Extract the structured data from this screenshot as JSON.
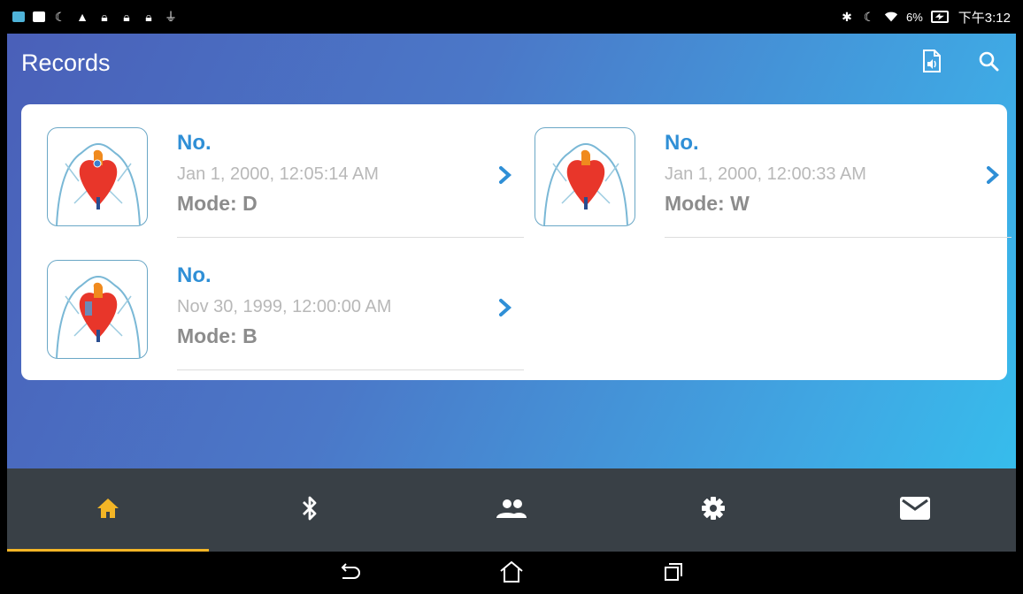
{
  "status_bar": {
    "battery_percent": "6%",
    "time": "下午3:12"
  },
  "app_bar": {
    "title": "Records",
    "icons": [
      "audio-file-icon",
      "search-icon"
    ]
  },
  "records": [
    {
      "no": "No.",
      "date": "Jan 1, 2000, 12:05:14 AM",
      "mode": "Mode: D"
    },
    {
      "no": "No.",
      "date": "Jan 1, 2000, 12:00:33 AM",
      "mode": "Mode: W"
    },
    {
      "no": "No.",
      "date": "Nov 30, 1999, 12:00:00 AM",
      "mode": "Mode: B"
    }
  ],
  "bottom_nav": {
    "tabs": [
      "home-icon",
      "bluetooth-icon",
      "people-icon",
      "gear-icon",
      "mail-icon"
    ],
    "active_tab": "home-icon"
  },
  "colors": {
    "accent": "#f3b526",
    "link_blue": "#2f8fd6",
    "nav_bg": "#394046"
  }
}
